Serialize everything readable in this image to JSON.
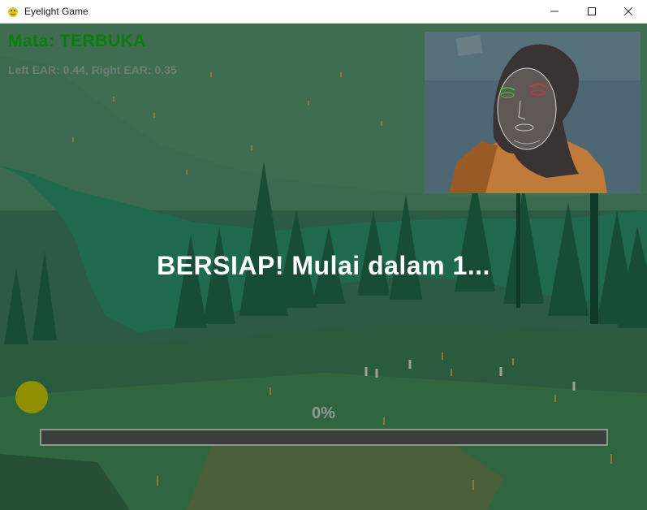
{
  "window": {
    "title": "Eyelight Game",
    "icon": "pygame-snake-icon",
    "controls": {
      "minimize": "minimize-icon",
      "maximize": "maximize-icon",
      "close": "close-icon"
    }
  },
  "hud": {
    "eye_status": "Mata: TERBUKA",
    "ear_readout": "Left EAR: 0.44, Right EAR: 0.35"
  },
  "countdown": {
    "text": "BERSIAP! Mulai dalam 1..."
  },
  "progress": {
    "label": "0%",
    "value": 0
  },
  "colors": {
    "eye_status": "#0a7d0a",
    "countdown": "#ffffff",
    "indicator": "#8f8f00",
    "bar_bg": "#3a3f3d",
    "bar_border": "#8c9890"
  }
}
